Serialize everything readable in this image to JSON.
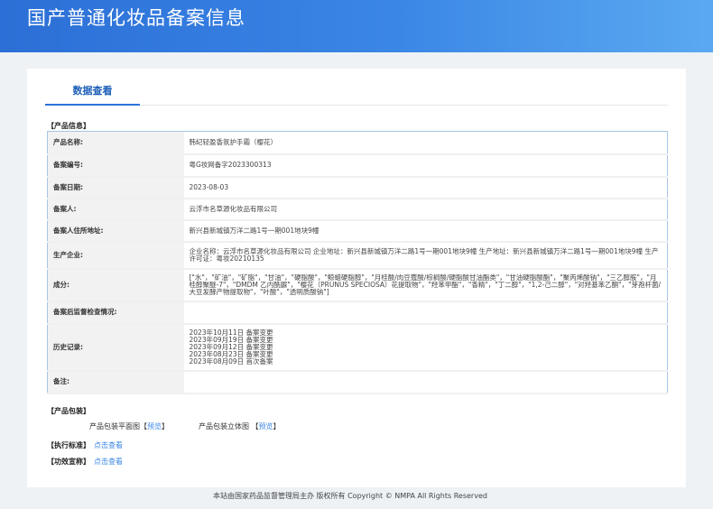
{
  "header": {
    "title": "国产普通化妆品备案信息"
  },
  "tab": {
    "label": "数据查看"
  },
  "product_info": {
    "section": "【产品信息】",
    "rows": [
      {
        "label": "产品名称:",
        "value": "韩纪轻盈香氛护手霜（樱花）"
      },
      {
        "label": "备案编号:",
        "value": "粤G妆网备字2023300313"
      },
      {
        "label": "备案日期:",
        "value": "2023-08-03"
      },
      {
        "label": "备案人:",
        "value": "云浮市名草源化妆品有限公司"
      },
      {
        "label": "备案人住所地址:",
        "value": "新兴县新城镇万洋二路1号一期001地块9幢"
      },
      {
        "label": "生产企业:",
        "value": "企业名称：云浮市名草源化妆品有限公司 企业地址：新兴县新城镇万洋二路1号一期001地块9幢 生产地址：新兴县新城镇万洋二路1号一期001地块9幢 生产许可证：粤妆20210135"
      },
      {
        "label": "成分:",
        "value": "[\"水\"，\"矿油\"，\"矿脂\"，\"甘油\"，\"硬脂酸\"，\"鲸蜡硬脂醇\"，\"月桂酸/肉豆蔻酸/棕榈酸/硬脂酸甘油酯类\"，\"甘油硬脂酸酯\"，\"聚丙烯酸钠\"，\"三乙醇胺\"，\"月桂醇聚醚-7\"，\"DMDM 乙内酰脲\"，\"樱花（PRUNUS SPECIOSA）花提取物\"，\"羟苯甲酯\"，\"香精\"，\"丁二醇\"，\"1,2-己二醇\"，\"对羟基苯乙酮\"，\"芽孢杆菌/大豆发酵产物提取物\"，\"叶酸\"，\"透明质酸钠\"]"
      },
      {
        "label": "备案后监督检查情况:",
        "value": ""
      },
      {
        "label": "历史记录:",
        "history": [
          "2023年10月11日 备案变更",
          "2023年09月19日 备案变更",
          "2023年09月12日 备案变更",
          "2023年08月23日 备案变更",
          "2023年08月09日 首次备案"
        ]
      },
      {
        "label": "备注:",
        "value": ""
      }
    ]
  },
  "packaging": {
    "section": "【产品包装】",
    "flat_label": "产品包装平面图",
    "solid_label": "产品包装立体图",
    "preview": "预览",
    "lb": "【",
    "rb": "】"
  },
  "standard": {
    "section": "【执行标准】",
    "link": "点击查看"
  },
  "efficacy": {
    "section": "【功效宣称】",
    "link": "点击查看"
  },
  "footer": {
    "text": "本站由国家药品监督管理局主办 版权所有 Copyright © NMPA All Rights Reserved"
  }
}
